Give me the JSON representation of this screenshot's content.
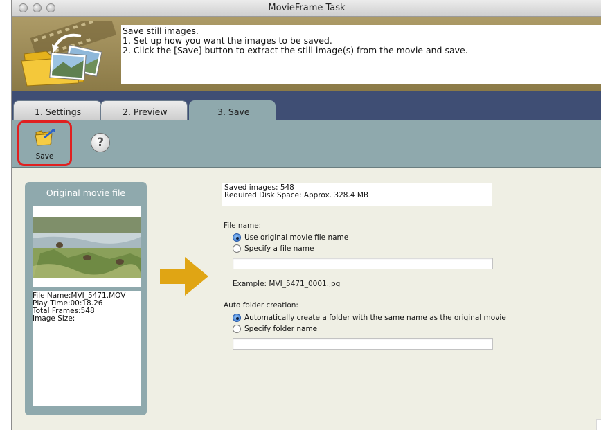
{
  "window": {
    "title": "MovieFrame Task"
  },
  "header": {
    "lines": [
      "Save still images.",
      "1. Set up how you want the images to be saved.",
      "2. Click the [Save] button to extract the still image(s) from the movie and save."
    ]
  },
  "tabs": [
    {
      "label": "1. Settings",
      "active": false
    },
    {
      "label": "2. Preview",
      "active": false
    },
    {
      "label": "3. Save",
      "active": true
    }
  ],
  "toolbar": {
    "save_label": "Save",
    "help_icon": "question-mark-icon"
  },
  "original": {
    "title": "Original movie file",
    "info": [
      "File Name:MVI_5471.MOV",
      "Play Time:00:18.26",
      "Total Frames:548",
      "Image Size:"
    ]
  },
  "summary": {
    "saved_images": "Saved images: 548",
    "disk_space": "Required Disk Space: Approx. 328.4 MB"
  },
  "file_name": {
    "label": "File name:",
    "option_original": "Use original movie file name",
    "option_specify": "Specify a file name",
    "selected": "original",
    "value": "",
    "example": "Example: MVI_5471_0001.jpg"
  },
  "folder": {
    "label": "Auto folder creation:",
    "option_auto": "Automatically create a folder with the same name as the original movie",
    "option_specify": "Specify folder name",
    "selected": "auto",
    "value": ""
  },
  "colors": {
    "accent_teal": "#8fa9ad",
    "tab_bar": "#3f4e74",
    "highlight_red": "#e02020",
    "arrow_gold": "#e0a514"
  }
}
